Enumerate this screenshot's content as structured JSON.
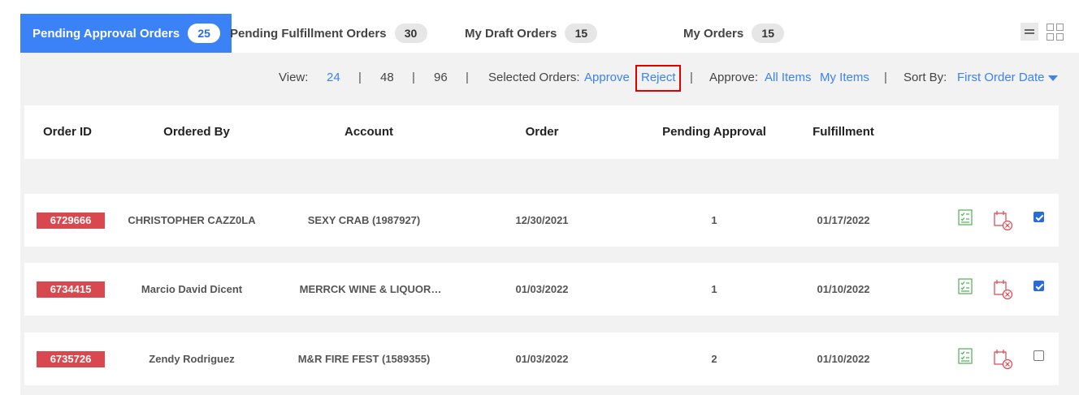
{
  "tabs": [
    {
      "label": "Pending Approval Orders",
      "count": "25",
      "active": true
    },
    {
      "label": "Pending Fulfillment Orders",
      "count": "30",
      "active": false
    },
    {
      "label": "My Draft Orders",
      "count": "15",
      "active": false
    },
    {
      "label": "My Orders",
      "count": "15",
      "active": false
    }
  ],
  "toolbar": {
    "view_label": "View:",
    "view_options": [
      "24",
      "48",
      "96"
    ],
    "view_selected": "24",
    "separator": "|",
    "selected_orders_label": "Selected Orders:",
    "approve_label": "Approve",
    "reject_label": "Reject",
    "approve_scope_label": "Approve:",
    "all_items_label": "All Items",
    "my_items_label": "My Items",
    "sort_by_label": "Sort By:",
    "sort_value": "First Order Date"
  },
  "colors": {
    "accent": "#3b82f6",
    "order_badge": "#d9474f",
    "highlight_border": "#e00000",
    "approve_icon": "#4caf50",
    "reject_icon": "#d9474f"
  },
  "icons": {
    "approve": "clipboard-checklist-icon",
    "reject": "calendar-cancel-icon",
    "sort": "caret-down-icon",
    "list_view": "list-view-icon",
    "grid_view": "grid-view-icon"
  },
  "table": {
    "columns": [
      "Order ID",
      "Ordered By",
      "Account",
      "Order",
      "Pending Approval",
      "Fulfillment"
    ],
    "rows": [
      {
        "order_id": "6729666",
        "ordered_by": "CHRISTOPHER CAZZ0LA",
        "account": "SEXY CRAB (1987927)",
        "order": "12/30/2021",
        "pending_approval": "1",
        "fulfillment": "01/17/2022",
        "selected": true
      },
      {
        "order_id": "6734415",
        "ordered_by": "Marcio David Dicent",
        "account": "MERRCK WINE & LIQUOR…",
        "order": "01/03/2022",
        "pending_approval": "1",
        "fulfillment": "01/10/2022",
        "selected": true
      },
      {
        "order_id": "6735726",
        "ordered_by": "Zendy Rodriguez",
        "account": "M&R FIRE FEST (1589355)",
        "order": "01/03/2022",
        "pending_approval": "2",
        "fulfillment": "01/10/2022",
        "selected": false
      }
    ]
  }
}
